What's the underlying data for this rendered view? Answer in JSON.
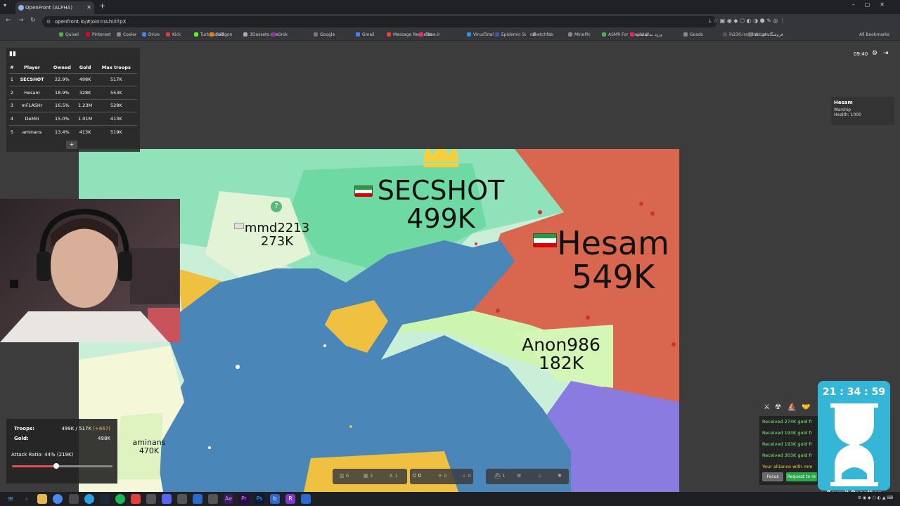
{
  "browser": {
    "tab_title": "OpenFront (ALPHA)",
    "url": "openfront.io/#join=sLhiXTpX",
    "bookmarks": [
      "Quixel",
      "Pinterest",
      "Cooler",
      "Drive",
      "Kick",
      "TurboSquid",
      "Polligon",
      "3Dassets.one",
      "Grok",
      "Google",
      "Gmail",
      "Message Requests",
      "Time.ir",
      "VirusTotal",
      "Epidemic Sound",
      "Sketchfab",
      "MinePlc",
      "ASMR For People W...",
      "ورود به سامانه",
      "Goods",
      "ih230.irandns.com",
      "فروشگاه ای کالا"
    ],
    "all_bookmarks": "All Bookmarks"
  },
  "leaderboard": {
    "headers": [
      "#",
      "Player",
      "Owned",
      "Gold",
      "Max troops"
    ],
    "rows": [
      [
        "1",
        "SECSHOT",
        "22.9%",
        "498K",
        "517K"
      ],
      [
        "2",
        "Hesam",
        "18.9%",
        "328K",
        "553K"
      ],
      [
        "3",
        "mFLASHr",
        "16.5%",
        "1.23M",
        "528K"
      ],
      [
        "4",
        "DeMili",
        "15.0%",
        "1.01M",
        "413K"
      ],
      [
        "5",
        "aminans",
        "13.4%",
        "413K",
        "519K"
      ]
    ],
    "expand": "+"
  },
  "hud": {
    "clock": "09:40"
  },
  "info_panel": {
    "name": "Hesam",
    "unit": "Warship",
    "health": "Health: 1000"
  },
  "map_labels": {
    "secshot": {
      "name": "SECSHOT",
      "troops": "499K"
    },
    "hesam": {
      "name": "Hesam",
      "troops": "549K"
    },
    "mmd": {
      "name": "mmd2213",
      "troops": "273K"
    },
    "anon": {
      "name": "Anon986",
      "troops": "182K"
    },
    "aminans": {
      "name": "aminans",
      "troops": "470K"
    }
  },
  "stats": {
    "troops_label": "Troops:",
    "troops_value": "499K / 517K",
    "troops_delta": "(+667)",
    "gold_label": "Gold:",
    "gold_value": "498K",
    "attack_ratio": "Attack Ratio: 44% (219K)",
    "attack_ratio_level": 0.44
  },
  "buildbar": {
    "city": "6",
    "factory": "3",
    "port": "1",
    "defense": "0",
    "sam": "0",
    "silo": "0",
    "warship": "1",
    "atom": "",
    "hydrogen": ""
  },
  "events": {
    "messages": [
      "Received 274K gold fr",
      "Received 193K gold fr",
      "Received 193K gold fr",
      "Received 303K gold fr",
      "Your alliance with mm"
    ],
    "focus_button": "Focus",
    "request_button": "Request to re"
  },
  "overlay": {
    "timer": "21 : 34 : 59",
    "donation": "Reymit Donathon"
  },
  "colors": {
    "ocean": "#4a86b8",
    "secshot": "#7ee0b0",
    "hesam": "#d9664f",
    "anon": "#cdf5b0",
    "yellow": "#f0c040",
    "purple": "#8a7be0",
    "land": "#c8f0e0",
    "timer_bg": "#36b6d6"
  }
}
